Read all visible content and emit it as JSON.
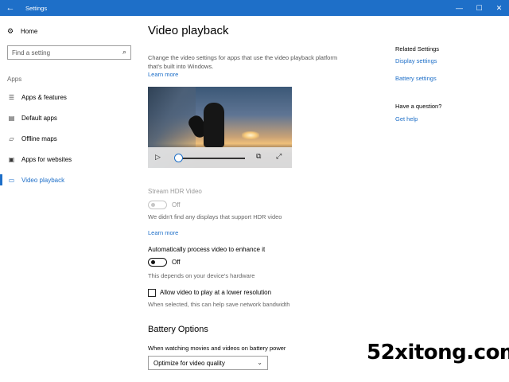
{
  "window": {
    "title": "Settings",
    "back_glyph": "←",
    "minimize_glyph": "—",
    "maximize_glyph": "☐",
    "close_glyph": "✕"
  },
  "sidebar": {
    "home_label": "Home",
    "search_placeholder": "Find a setting",
    "section_header": "Apps",
    "items": [
      {
        "label": "Apps & features",
        "icon": "list-icon"
      },
      {
        "label": "Default apps",
        "icon": "default-apps-icon"
      },
      {
        "label": "Offline maps",
        "icon": "map-icon"
      },
      {
        "label": "Apps for websites",
        "icon": "link-apps-icon"
      },
      {
        "label": "Video playback",
        "icon": "video-icon",
        "active": true
      }
    ]
  },
  "main": {
    "title": "Video playback",
    "description": "Change the video settings for apps that use the video playback platform that's built into Windows.",
    "learn_more": "Learn more",
    "hdr": {
      "title": "Stream HDR Video",
      "toggle_state": "Off",
      "note": "We didn't find any displays that support HDR video",
      "learn_more": "Learn more"
    },
    "auto_process": {
      "title": "Automatically process video to enhance it",
      "toggle_state": "Off",
      "note": "This depends on your device's hardware"
    },
    "lower_res": {
      "label": "Allow video to play at a lower resolution",
      "checked": false,
      "note": "When selected, this can help save network bandwidth"
    },
    "battery": {
      "heading": "Battery Options",
      "subheading": "When watching movies and videos on battery power",
      "selected": "Optimize for video quality"
    }
  },
  "related": {
    "heading": "Related Settings",
    "links": [
      "Display settings",
      "Battery settings"
    ],
    "question_heading": "Have a question?",
    "help_link": "Get help"
  },
  "watermark": "52xitong.com",
  "colors": {
    "accent": "#1e6fc8"
  }
}
